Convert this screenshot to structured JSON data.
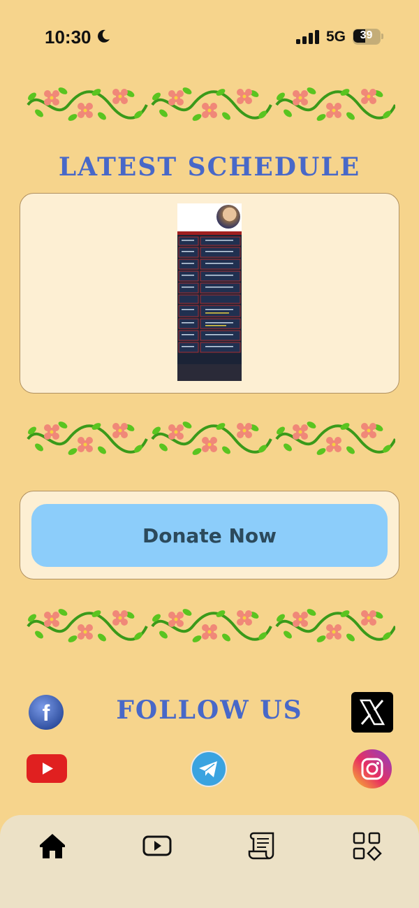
{
  "status_bar": {
    "time": "10:30",
    "network": "5G",
    "battery": "39",
    "icons": [
      "moon-icon",
      "signal-icon",
      "battery-icon"
    ]
  },
  "schedule": {
    "title": "LATEST SCHEDULE"
  },
  "donate": {
    "label": "Donate Now"
  },
  "follow": {
    "title": "FOLLOW US",
    "links": [
      "facebook-icon",
      "x-icon",
      "youtube-icon",
      "telegram-icon",
      "instagram-icon"
    ]
  },
  "tab_bar": {
    "icons": [
      "home-icon",
      "video-icon",
      "scroll-icon",
      "grid-icon"
    ]
  },
  "colors": {
    "background": "#f6d48c",
    "title": "#4868c8",
    "donate_button": "#8ccdfa",
    "card": "#fdefd3",
    "tab_bar": "#ece1c6"
  }
}
